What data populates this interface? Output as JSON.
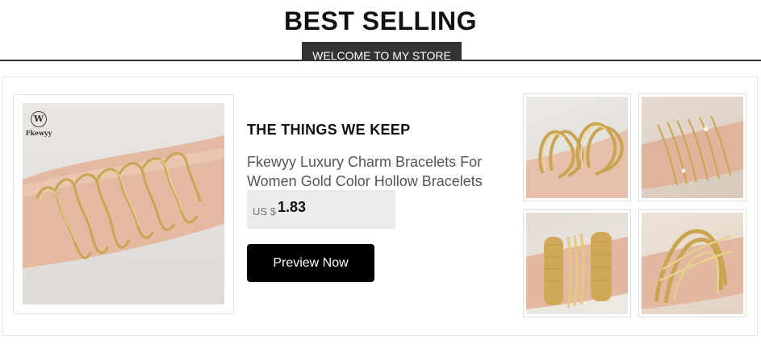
{
  "header": {
    "title": "BEST SELLING",
    "welcome": "WELCOME TO MY STORE"
  },
  "brand": {
    "mark": "W",
    "name": "Fkewyy"
  },
  "product": {
    "section_title": "THE THINGS WE KEEP",
    "name": "Fkewyy Luxury Charm Bracelets For Women Gold Color Hollow Bracelets",
    "price_currency": "US $",
    "price_value": "1.83",
    "button_label": "Preview Now"
  },
  "colors": {
    "gold": "#c9a552",
    "gold_light": "#e8d08e",
    "skin": "#e3b9a2",
    "button_bg": "#000000",
    "price_bg": "#ebebeb",
    "badge_bg": "#333333"
  },
  "icons": {
    "brand_logo": "w-circle-logo"
  }
}
